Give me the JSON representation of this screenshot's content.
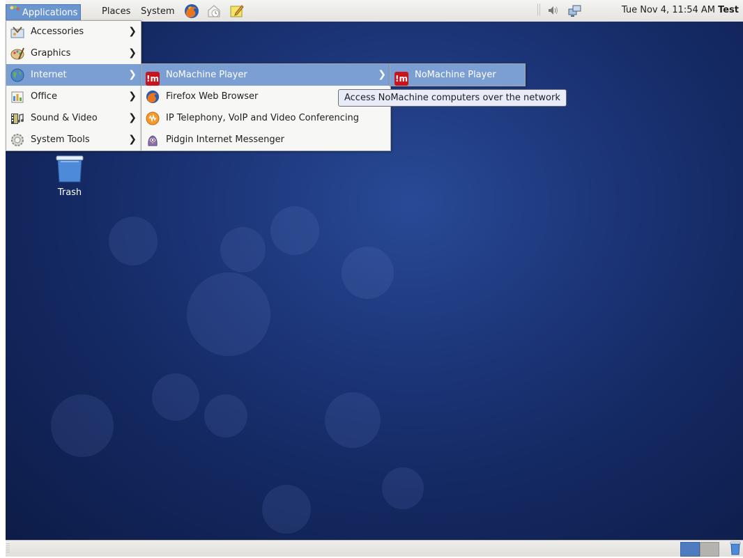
{
  "top_panel": {
    "menus": [
      "Applications",
      "Places",
      "System"
    ],
    "launchers": [
      "firefox-icon",
      "evolution-icon",
      "notes-icon"
    ],
    "tray_icons": [
      "volume-icon",
      "network-icon"
    ],
    "clock": "Tue Nov  4, 11:54 AM",
    "user": "Test"
  },
  "desktop": {
    "icons": [
      {
        "label": "Trash",
        "icon": "trash-icon"
      }
    ]
  },
  "applications_menu": {
    "items": [
      {
        "label": "Accessories",
        "icon": "accessories-icon",
        "has_submenu": true
      },
      {
        "label": "Graphics",
        "icon": "graphics-icon",
        "has_submenu": true
      },
      {
        "label": "Internet",
        "icon": "internet-icon",
        "has_submenu": true,
        "active": true
      },
      {
        "label": "Office",
        "icon": "office-icon",
        "has_submenu": true
      },
      {
        "label": "Sound & Video",
        "icon": "sound-video-icon",
        "has_submenu": true
      },
      {
        "label": "System Tools",
        "icon": "system-tools-icon",
        "has_submenu": true
      }
    ]
  },
  "internet_submenu": {
    "items": [
      {
        "label": "NoMachine Player",
        "icon": "nomachine-icon",
        "has_submenu": true,
        "active": true
      },
      {
        "label": "Firefox Web Browser",
        "icon": "firefox-icon",
        "has_submenu": false
      },
      {
        "label": "IP Telephony, VoIP and Video Conferencing",
        "icon": "voip-icon",
        "has_submenu": false
      },
      {
        "label": "Pidgin Internet Messenger",
        "icon": "pidgin-icon",
        "has_submenu": false
      }
    ]
  },
  "nomachine_submenu": {
    "items": [
      {
        "label": "NoMachine Player",
        "icon": "nomachine-icon",
        "active": true
      }
    ],
    "nomachine_icon_text": "!m"
  },
  "tooltip": {
    "text": "Access NoMachine computers over the network"
  },
  "bottom_panel": {
    "workspaces": [
      "workspace-1",
      "workspace-2"
    ]
  },
  "colors": {
    "menu_highlight": "#7b9fd3",
    "desktop_bg": "#1c3578",
    "nomachine_red": "#c8141c"
  }
}
